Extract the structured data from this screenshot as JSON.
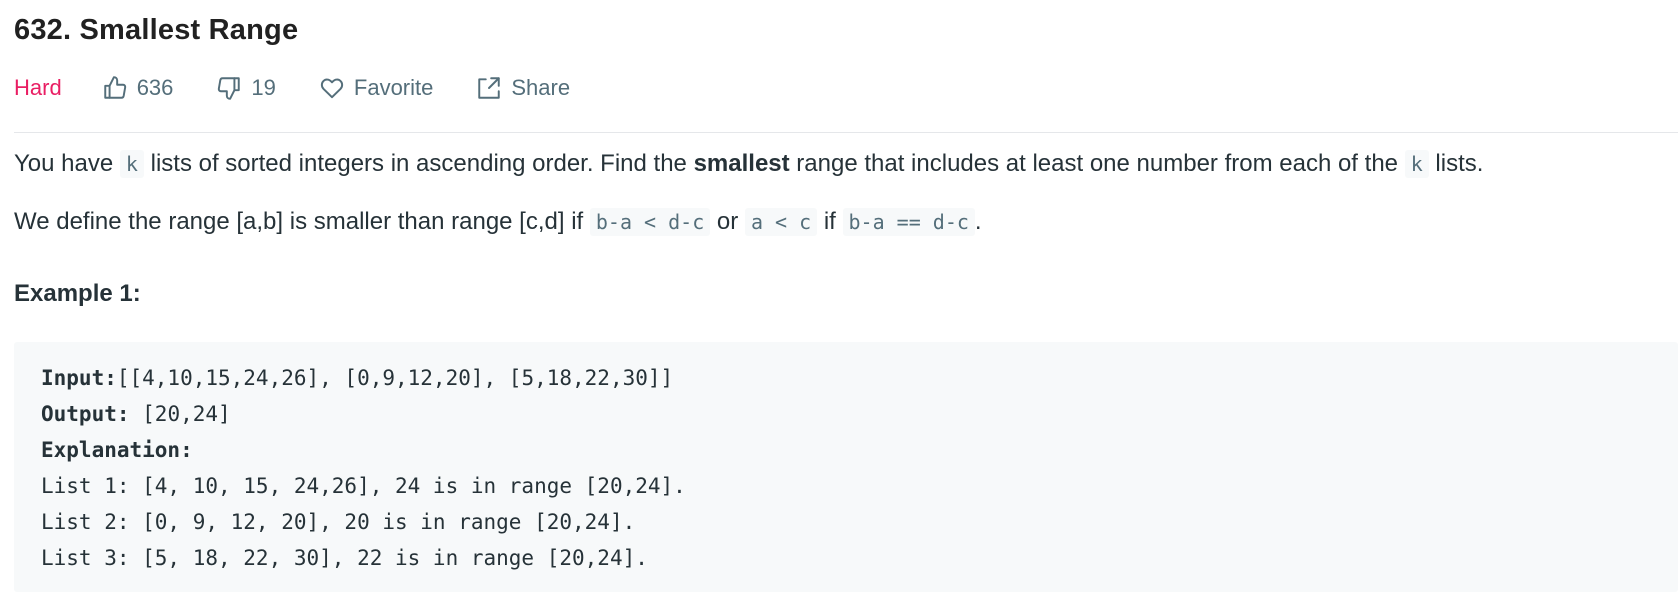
{
  "problem": {
    "title": "632. Smallest Range",
    "difficulty": "Hard",
    "likes": "636",
    "dislikes": "19",
    "favorite_label": "Favorite",
    "share_label": "Share",
    "difficulty_color": "#e91e63"
  },
  "description": {
    "p1": {
      "t1": "You have ",
      "c1": "k",
      "t2": " lists of sorted integers in ascending order. Find the ",
      "bold": "smallest",
      "t3": " range that includes at least one number from each of the ",
      "c2": "k",
      "t4": " lists."
    },
    "p2": {
      "t1": "We define the range [a,b] is smaller than range [c,d] if ",
      "c1": "b-a < d-c",
      "t2": " or ",
      "c2": "a < c",
      "t3": " if ",
      "c3": "b-a == d-c",
      "t4": "."
    }
  },
  "example": {
    "heading": "Example 1:",
    "input_label": "Input:",
    "input_value": "[[4,10,15,24,26], [0,9,12,20], [5,18,22,30]]",
    "output_label": "Output:",
    "output_value": " [20,24]",
    "explanation_label": "Explanation:",
    "lines": [
      "List 1: [4, 10, 15, 24,26], 24 is in range [20,24].",
      "List 2: [0, 9, 12, 20], 20 is in range [20,24].",
      "List 3: [5, 18, 22, 30], 22 is in range [20,24]."
    ]
  },
  "icons": {
    "like": "thumbs-up-icon",
    "dislike": "thumbs-down-icon",
    "favorite": "heart-icon",
    "share": "share-icon"
  }
}
